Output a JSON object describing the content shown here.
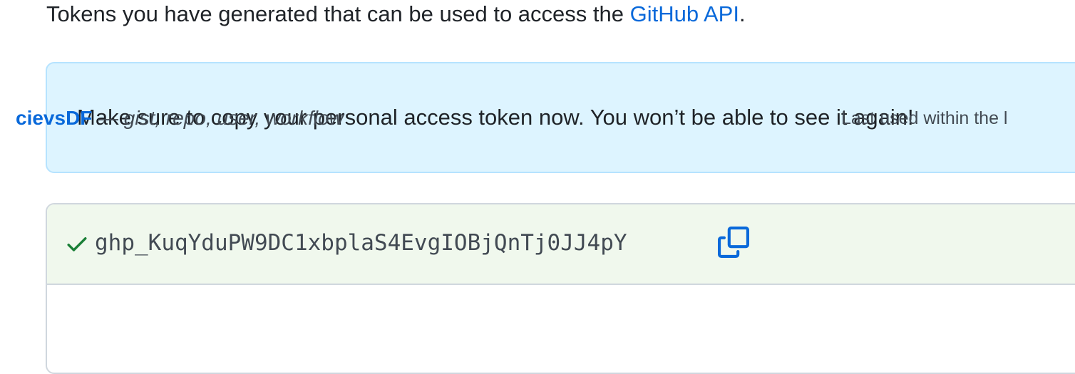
{
  "intro": {
    "text_before": "Tokens you have generated that can be used to access the ",
    "link_label": "GitHub API",
    "text_after": "."
  },
  "flash": {
    "message": "Make sure to copy your personal access token now. You won’t be able to see it again!"
  },
  "new_token": {
    "value": "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",
    "status_icon": "check-icon",
    "copy_icon": "copy-icon"
  },
  "token_row": {
    "name": "cievsDF",
    "separator": "—",
    "scopes": "gist, repo, user, workflow",
    "last_used": "Last used within the l"
  },
  "colors": {
    "link": "#0969da",
    "flash_bg": "#ddf4ff",
    "flash_border": "#b6e3ff",
    "success_bg": "#f0f8ed",
    "success_icon": "#1a7f37",
    "border": "#d0d7de"
  }
}
